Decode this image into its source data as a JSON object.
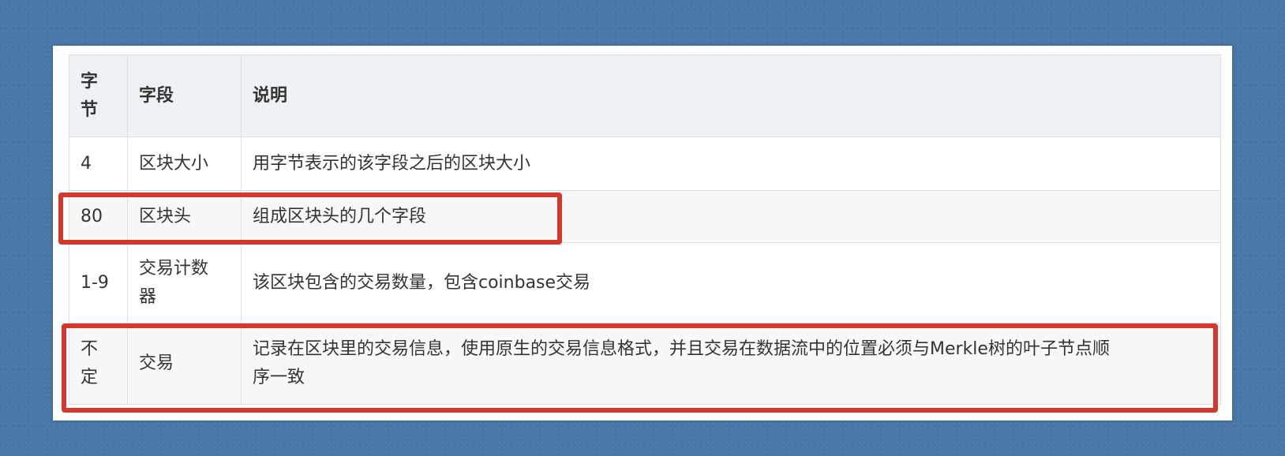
{
  "table": {
    "headers": [
      "字节",
      "字段",
      "说明"
    ],
    "header_byte_lines": [
      "字",
      "节"
    ],
    "rows": [
      {
        "bytes_lines": [
          "4"
        ],
        "field_lines": [
          "区块大小"
        ],
        "desc_lines": [
          "用字节表示的该字段之后的区块大小"
        ]
      },
      {
        "bytes_lines": [
          "80"
        ],
        "field_lines": [
          "区块头"
        ],
        "desc_lines": [
          "组成区块头的几个字段"
        ]
      },
      {
        "bytes_lines": [
          "1-9"
        ],
        "field_lines": [
          "交易计数",
          "器"
        ],
        "desc_lines": [
          "该区块包含的交易数量，包含coinbase交易"
        ]
      },
      {
        "bytes_lines": [
          "不",
          "定"
        ],
        "field_lines": [
          "交易"
        ],
        "desc_lines": [
          "记录在区块里的交易信息，使用原生的交易信息格式，并且交易在数据流中的位置必须与Merkle树的叶子节点顺",
          "序一致"
        ]
      }
    ]
  },
  "highlight_color": "#d2382b",
  "background_color": "#4a77a7"
}
